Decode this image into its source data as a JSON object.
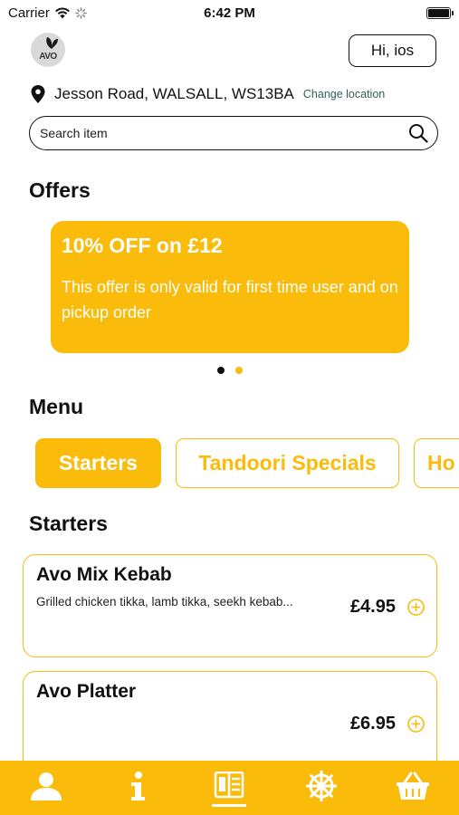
{
  "status_bar": {
    "carrier": "Carrier",
    "time": "6:42 PM"
  },
  "header": {
    "logo_text": "AVO",
    "greeting": "Hi, ios"
  },
  "location": {
    "address": "Jesson Road, WALSALL, WS13BA",
    "change_label": "Change location"
  },
  "search": {
    "placeholder": "Search item"
  },
  "offers": {
    "title": "Offers",
    "cards": [
      {
        "title": "10% OFF on £12",
        "description": "This offer is only valid for first time user and on pickup order"
      }
    ],
    "pager": {
      "total": 2,
      "active_index": 0
    }
  },
  "menu": {
    "title": "Menu",
    "tabs": [
      {
        "label": "Starters",
        "active": true
      },
      {
        "label": "Tandoori Specials",
        "active": false
      },
      {
        "label": "Ho",
        "active": false
      }
    ]
  },
  "category": {
    "title": "Starters",
    "items": [
      {
        "name": "Avo Mix Kebab",
        "description": "Grilled chicken tikka, lamb tikka, seekh kebab...",
        "price": "£4.95"
      },
      {
        "name": "Avo Platter",
        "description": "",
        "price": "£6.95"
      }
    ]
  },
  "bottom_nav": {
    "items": [
      {
        "icon": "profile-icon",
        "active": false
      },
      {
        "icon": "info-icon",
        "active": false
      },
      {
        "icon": "menu-icon",
        "active": true
      },
      {
        "icon": "wheel-icon",
        "active": false
      },
      {
        "icon": "basket-icon",
        "active": false
      }
    ]
  },
  "colors": {
    "accent": "#fbbb0a",
    "text": "#111111",
    "link": "#2f5f57"
  }
}
